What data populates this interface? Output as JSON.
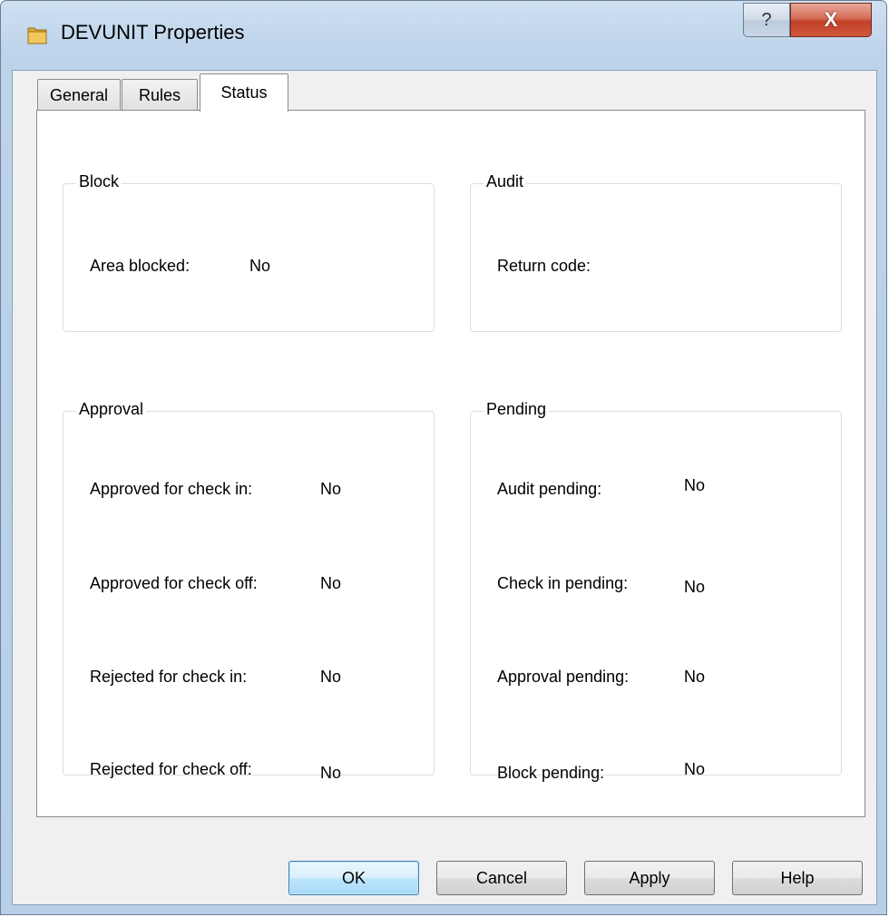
{
  "window": {
    "title": "DEVUNIT Properties",
    "help_glyph": "?",
    "close_glyph": "X"
  },
  "tabs": [
    {
      "label": "General",
      "active": false
    },
    {
      "label": "Rules",
      "active": false
    },
    {
      "label": "Status",
      "active": true
    }
  ],
  "groups": {
    "block": {
      "title": "Block",
      "fields": [
        {
          "label": "Area blocked:",
          "value": "No"
        }
      ]
    },
    "audit": {
      "title": "Audit",
      "fields": [
        {
          "label": "Return code:",
          "value": ""
        }
      ]
    },
    "approval": {
      "title": "Approval",
      "fields": [
        {
          "label": "Approved for check in:",
          "value": "No"
        },
        {
          "label": "Approved for check off:",
          "value": "No"
        },
        {
          "label": "Rejected for check in:",
          "value": "No"
        },
        {
          "label": "Rejected for check off:",
          "value": "No"
        }
      ]
    },
    "pending": {
      "title": "Pending",
      "fields": [
        {
          "label": "Audit pending:",
          "value": "No"
        },
        {
          "label": "Check in pending:",
          "value": "No"
        },
        {
          "label": "Approval pending:",
          "value": "No"
        },
        {
          "label": "Block pending:",
          "value": "No"
        }
      ]
    }
  },
  "buttons": {
    "ok": "OK",
    "cancel": "Cancel",
    "apply": "Apply",
    "help": "Help"
  },
  "colors": {
    "title_bar": "#bcd3ea",
    "close_button": "#c23f27",
    "default_button": "#bee6fd"
  }
}
